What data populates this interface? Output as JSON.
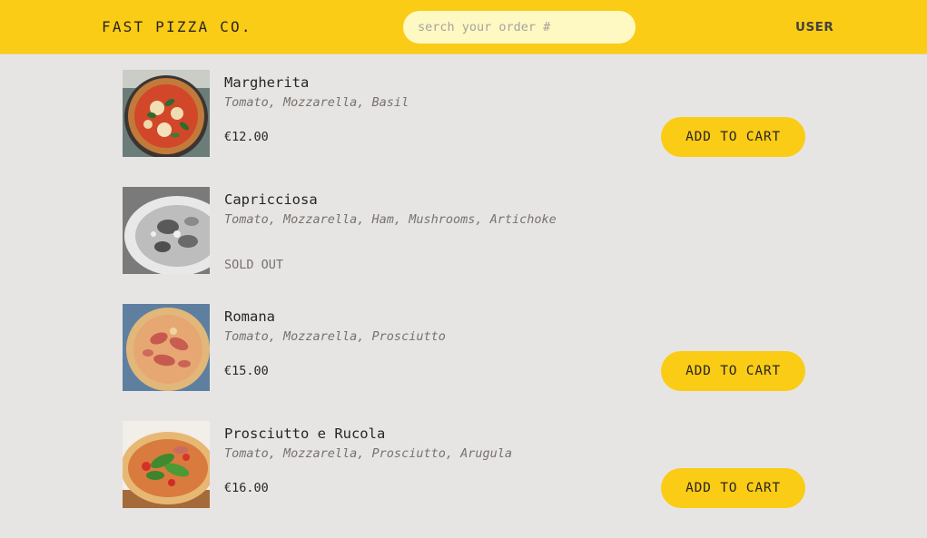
{
  "header": {
    "brand": "FAST PIZZA CO.",
    "search_placeholder": "serch your order #",
    "search_value": "",
    "user": "USER"
  },
  "menu": {
    "items": [
      {
        "name": "Margherita",
        "ingredients": "Tomato, Mozzarella, Basil",
        "price": "€12.00",
        "action": "ADD TO CART",
        "sold_out": false
      },
      {
        "name": "Capricciosa",
        "ingredients": "Tomato, Mozzarella, Ham, Mushrooms, Artichoke",
        "price": "SOLD OUT",
        "sold_out": true
      },
      {
        "name": "Romana",
        "ingredients": "Tomato, Mozzarella, Prosciutto",
        "price": "€15.00",
        "action": "ADD TO CART",
        "sold_out": false
      },
      {
        "name": "Prosciutto e Rucola",
        "ingredients": "Tomato, Mozzarella, Prosciutto, Arugula",
        "price": "€16.00",
        "action": "ADD TO CART",
        "sold_out": false
      }
    ]
  },
  "colors": {
    "accent": "#facc15",
    "search_bg": "#fef9c3",
    "background": "#e7e5e4",
    "text": "#292524",
    "muted": "#78716c"
  }
}
